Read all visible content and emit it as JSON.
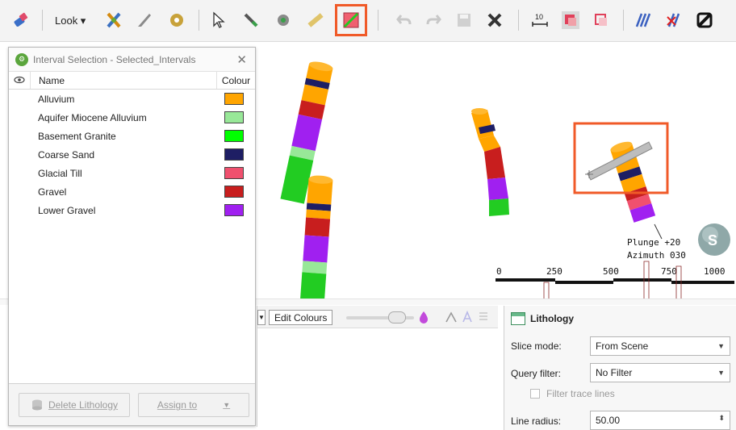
{
  "toolbar": {
    "look_label": "Look ▾"
  },
  "interval_panel": {
    "title": "Interval Selection - Selected_Intervals",
    "close": "✕",
    "columns": {
      "name": "Name",
      "colour": "Colour"
    },
    "rows": [
      {
        "name": "Alluvium",
        "colour": "#ffa500"
      },
      {
        "name": "Aquifer Miocene Alluvium",
        "colour": "#98e898"
      },
      {
        "name": "Basement Granite",
        "colour": "#00ff00"
      },
      {
        "name": "Coarse Sand",
        "colour": "#1e1e64"
      },
      {
        "name": "Glacial Till",
        "colour": "#f0506e"
      },
      {
        "name": "Gravel",
        "colour": "#c81e1e"
      },
      {
        "name": "Lower Gravel",
        "colour": "#a020f0"
      }
    ],
    "delete_button": "Delete Lithology",
    "assign_button": "Assign to"
  },
  "mid_toolbar": {
    "edit_colours": "Edit Colours"
  },
  "properties": {
    "title": "Lithology",
    "slice_mode_label": "Slice mode:",
    "slice_mode_value": "From Scene",
    "query_filter_label": "Query filter:",
    "query_filter_value": "No Filter",
    "filter_trace_label": "Filter trace lines",
    "line_radius_label": "Line radius:",
    "line_radius_value": "50.00"
  },
  "scene": {
    "plunge": "Plunge +20",
    "azimuth": "Azimuth 030",
    "scale_labels": [
      "0",
      "250",
      "500",
      "750",
      "1000"
    ],
    "compass_letter": "S"
  },
  "colors": {
    "highlight": "#f05a28",
    "accent_green": "#5aa53c"
  }
}
